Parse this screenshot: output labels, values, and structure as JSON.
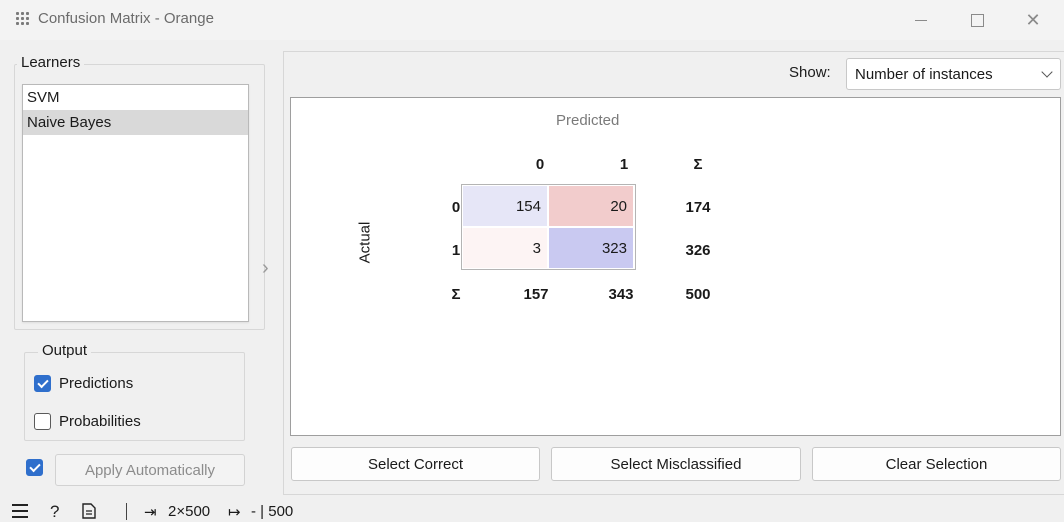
{
  "window": {
    "title": "Confusion Matrix - Orange",
    "minimize_glyph": "—",
    "close_glyph": "✕"
  },
  "learners": {
    "title": "Learners",
    "items": [
      "SVM",
      "Naive Bayes"
    ],
    "selected_index": 1
  },
  "output": {
    "title": "Output",
    "predictions_label": "Predictions",
    "predictions_checked": true,
    "probabilities_label": "Probabilities",
    "probabilities_checked": false
  },
  "apply": {
    "label": "Apply Automatically",
    "auto_checked": true
  },
  "show": {
    "label": "Show:",
    "selected": "Number of instances"
  },
  "matrix": {
    "predicted_label": "Predicted",
    "actual_label": "Actual",
    "col_headers": [
      "0",
      "1",
      "Σ"
    ],
    "row_headers": [
      "0",
      "1",
      "Σ"
    ],
    "cells": [
      [
        "154",
        "20"
      ],
      [
        "3",
        "323"
      ]
    ],
    "row_totals": [
      "174",
      "326"
    ],
    "col_totals": [
      "157",
      "343"
    ],
    "grand_total": "500",
    "colors": {
      "correct_0": "#e6e6f7",
      "wrong_0_1": "#f2cccc",
      "wrong_1_0": "#fdf4f4",
      "correct_1": "#c9c9f1"
    }
  },
  "buttons": {
    "select_correct": "Select Correct",
    "select_misclassified": "Select Misclassified",
    "clear_selection": "Clear Selection"
  },
  "status": {
    "input_summary": "2×500",
    "output_summary": "- | 500",
    "input_icon": "⇥",
    "output_icon": "↦"
  },
  "icons": {
    "app": "orange-grid-icon",
    "menu": "hamburger-icon",
    "help": "help-icon",
    "report": "report-icon",
    "expander": "›"
  }
}
